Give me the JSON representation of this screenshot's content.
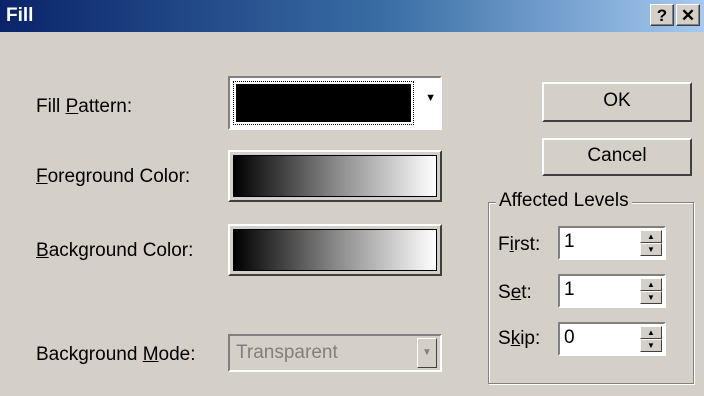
{
  "window": {
    "title": "Fill",
    "help_glyph": "?",
    "close_glyph": "✕"
  },
  "labels": {
    "fill_pattern_pre": "Fill ",
    "fill_pattern_ul": "P",
    "fill_pattern_post": "attern:",
    "foreground_ul": "F",
    "foreground_post": "oreground Color:",
    "background_ul": "B",
    "background_post": "ackground Color:",
    "bgmode_pre": "Background ",
    "bgmode_ul": "M",
    "bgmode_post": "ode:"
  },
  "controls": {
    "background_mode_value": "Transparent",
    "fill_pattern_value_color": "#000000"
  },
  "buttons": {
    "ok": "OK",
    "cancel": "Cancel"
  },
  "affected_levels": {
    "title": "Affected Levels",
    "first_pre": "F",
    "first_ul": "i",
    "first_post": "rst:",
    "first_value": "1",
    "set_pre": "S",
    "set_ul": "e",
    "set_post": "t:",
    "set_value": "1",
    "skip_pre": "S",
    "skip_ul": "k",
    "skip_post": "ip:",
    "skip_value": "0"
  },
  "icons": {
    "dropdown": "▼",
    "spin_up": "▲",
    "spin_down": "▼"
  }
}
